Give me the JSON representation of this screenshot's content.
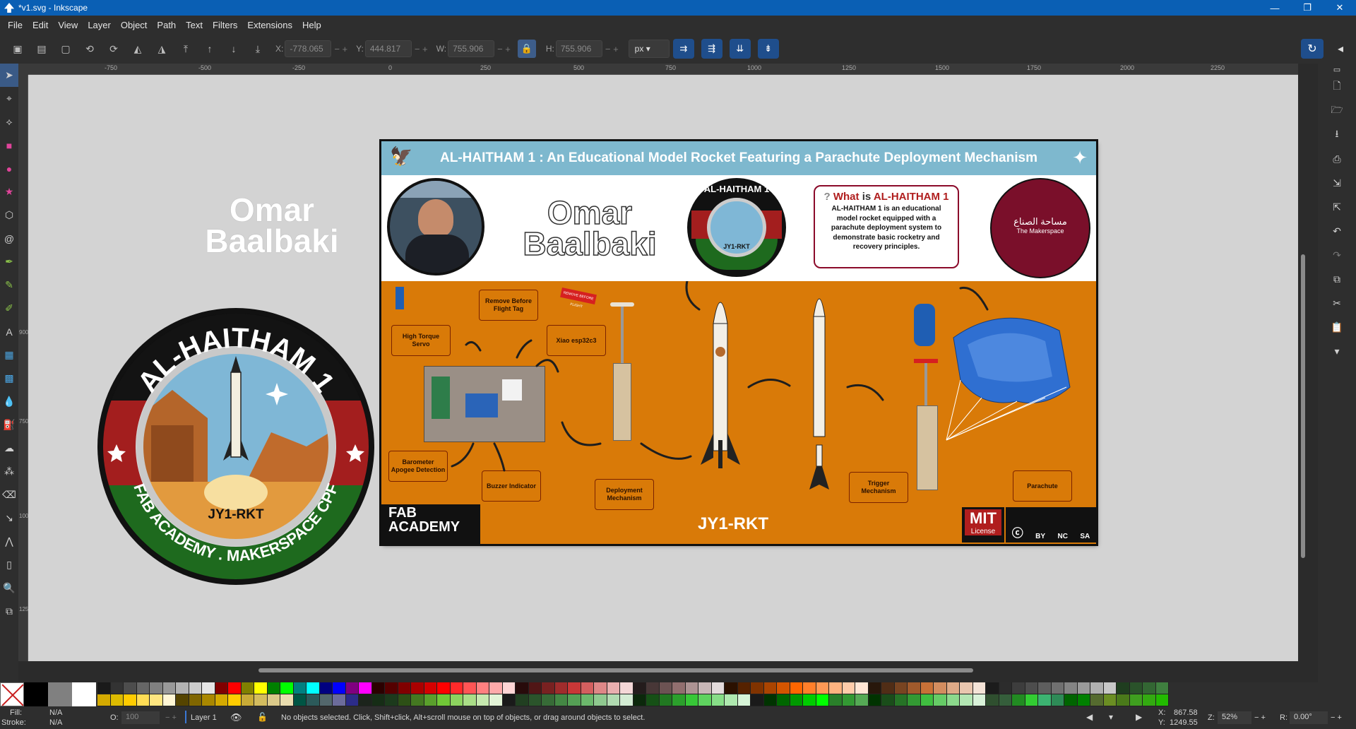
{
  "window": {
    "title": "*v1.svg - Inkscape",
    "min": "—",
    "max": "❐",
    "close": "✕"
  },
  "menu": [
    "File",
    "Edit",
    "View",
    "Layer",
    "Object",
    "Path",
    "Text",
    "Filters",
    "Extensions",
    "Help"
  ],
  "toolctrl": {
    "x_label": "X:",
    "x_value": "-778.065",
    "y_label": "Y:",
    "y_value": "444.817",
    "w_label": "W:",
    "w_value": "755.906",
    "h_label": "H:",
    "h_value": "755.906",
    "unit": "px"
  },
  "ruler": {
    "h": [
      "-750",
      "-500",
      "-250",
      "0",
      "250",
      "500",
      "750",
      "1000",
      "1250",
      "1500",
      "1750",
      "2000",
      "2250"
    ],
    "v": [
      "750",
      "900",
      "750",
      "1000",
      "1250"
    ]
  },
  "artwork": {
    "name_first": "Omar",
    "name_last": "Baalbaki",
    "badge_title": "AL-HAITHAM 1",
    "badge_code": "JY1-RKT",
    "badge_footer": "FAB ACADEMY . MAKERSPACE CPF",
    "poster_title": "AL-HAITHAM 1 : An Educational Model Rocket Featuring a Parachute Deployment Mechanism",
    "what_prefix": "What",
    "what_is": "is",
    "what_name": "AL-HAITHAM 1",
    "what_body": "AL-HAITHAM 1 is an educational model rocket equipped with a parachute deployment system to demonstrate basic rocketry and recovery principles.",
    "makerspace_ar": "مساحة الصناع",
    "makerspace_en": "The Makerspace",
    "labels": {
      "remove_tag": "Remove Before Flight Tag",
      "servo": "High Torque Servo",
      "xiao": "Xiao esp32c3",
      "barometer": "Barometer Apogee Detection",
      "buzzer": "Buzzer Indicator",
      "deployment": "Deployment Mechanism",
      "trigger": "Trigger Mechanism",
      "parachute": "Parachute",
      "tag_red": "REMOVE BEFORE FLIGHT"
    },
    "rocket_code": "JY1-RKT",
    "fab_line1": "FAB",
    "fab_line2": "ACADEMY",
    "mit": "MIT",
    "license": "License",
    "cc": [
      "BY",
      "NC",
      "SA"
    ]
  },
  "status": {
    "fill_label": "Fill:",
    "fill_value": "N/A",
    "stroke_label": "Stroke:",
    "stroke_value": "N/A",
    "opacity_label": "O:",
    "opacity_value": "100",
    "layer": "Layer 1",
    "message": "No objects selected. Click, Shift+click, Alt+scroll mouse on top of objects, or drag around objects to select.",
    "x_label": "X:",
    "x_value": "867.58",
    "y_label": "Y:",
    "y_value": "1249.55",
    "zoom_label": "Z:",
    "zoom_value": "52%",
    "rot_label": "R:",
    "rot_value": "0.00°"
  },
  "palette": {
    "big": [
      "#000000",
      "#808080",
      "#ffffff"
    ],
    "grid": [
      [
        "#1a1a1a",
        "#d4aa00"
      ],
      [
        "#333333",
        "#ddbb00"
      ],
      [
        "#4d4d4d",
        "#ffcc00"
      ],
      [
        "#666666",
        "#ffdd55"
      ],
      [
        "#808080",
        "#ffe680"
      ],
      [
        "#999999",
        "#fff6d5"
      ],
      [
        "#b3b3b3",
        "#554400"
      ],
      [
        "#cccccc",
        "#806600"
      ],
      [
        "#e6e6e6",
        "#aa8800"
      ],
      [
        "#800000",
        "#d4aa00"
      ],
      [
        "#ff0000",
        "#ffcc00"
      ],
      [
        "#808000",
        "#c8ab37"
      ],
      [
        "#ffff00",
        "#d3bc5f"
      ],
      [
        "#008000",
        "#dbc98a"
      ],
      [
        "#00ff00",
        "#e9ddaf"
      ],
      [
        "#008080",
        "#005544"
      ],
      [
        "#00ffff",
        "#2c5a5a"
      ],
      [
        "#000080",
        "#53676c"
      ],
      [
        "#0000ff",
        "#6c6c9b"
      ],
      [
        "#800080",
        "#2c2c89"
      ],
      [
        "#ff00ff",
        "#1c241c"
      ],
      [
        "#2b0000",
        "#162d16"
      ],
      [
        "#550000",
        "#1c3a1c"
      ],
      [
        "#800000",
        "#2d5016"
      ],
      [
        "#aa0000",
        "#447821"
      ],
      [
        "#d40000",
        "#5aa02c"
      ],
      [
        "#ff0000",
        "#71c837"
      ],
      [
        "#ff2a2a",
        "#8dd35f"
      ],
      [
        "#ff5555",
        "#aade87"
      ],
      [
        "#ff8080",
        "#c6e9af"
      ],
      [
        "#ffaaaa",
        "#e3f4d7"
      ],
      [
        "#ffd5d5",
        "#1a1a1a"
      ],
      [
        "#280b0b",
        "#213f21"
      ],
      [
        "#501616",
        "#2b542b"
      ],
      [
        "#782121",
        "#376b37"
      ],
      [
        "#a02c2c",
        "#448844"
      ],
      [
        "#c83737",
        "#55a055"
      ],
      [
        "#d35f5f",
        "#6cb86c"
      ],
      [
        "#de8787",
        "#8fc98f"
      ],
      [
        "#e9afaf",
        "#b1dbb1"
      ],
      [
        "#f4d7d7",
        "#d4ecd4"
      ],
      [
        "#241c1c",
        "#0b280b"
      ],
      [
        "#483737",
        "#165016"
      ],
      [
        "#6c5353",
        "#217821"
      ],
      [
        "#916f6f",
        "#2ca02c"
      ],
      [
        "#ac9393",
        "#37c837"
      ],
      [
        "#c8b7b7",
        "#5fd35f"
      ],
      [
        "#e3dbdb",
        "#87de87"
      ],
      [
        "#2b1100",
        "#afe9af"
      ],
      [
        "#552200",
        "#d7f4d7"
      ],
      [
        "#803300",
        "#1a1a1a"
      ],
      [
        "#aa4400",
        "#003300"
      ],
      [
        "#d45500",
        "#006600"
      ],
      [
        "#ff6600",
        "#009900"
      ],
      [
        "#ff7f2a",
        "#00cc00"
      ],
      [
        "#ff9955",
        "#00ff00"
      ],
      [
        "#ffb380",
        "#2a7f2a"
      ],
      [
        "#ffccaa",
        "#339933"
      ],
      [
        "#ffe6d5",
        "#55aa55"
      ],
      [
        "#28170b",
        "#003300"
      ],
      [
        "#502d16",
        "#1a4d1a"
      ],
      [
        "#784421",
        "#267326"
      ],
      [
        "#a05a2c",
        "#339933"
      ],
      [
        "#c87137",
        "#40bf40"
      ],
      [
        "#d38d5f",
        "#66cc66"
      ],
      [
        "#deaa87",
        "#8cd98c"
      ],
      [
        "#e9c6af",
        "#b3e6b3"
      ],
      [
        "#f4e3d7",
        "#d9f2d9"
      ],
      [
        "#1c1c1c",
        "#2f4f2f"
      ],
      [
        "#2c2c2c",
        "#355e3b"
      ],
      [
        "#3d3d3d",
        "#228b22"
      ],
      [
        "#4d4d4d",
        "#32cd32"
      ],
      [
        "#5e5e5e",
        "#3cb371"
      ],
      [
        "#707070",
        "#2e8b57"
      ],
      [
        "#848484",
        "#006400"
      ],
      [
        "#9a9a9a",
        "#008000"
      ],
      [
        "#b0b0b0",
        "#556b2f"
      ],
      [
        "#c8c8c8",
        "#6b8e23"
      ],
      [
        "#1f3d1f",
        "#4a7a1a"
      ],
      [
        "#2a522a",
        "#3f9f1f"
      ],
      [
        "#336633",
        "#33aa11"
      ],
      [
        "#3f7f3f",
        "#22bb00"
      ]
    ]
  }
}
